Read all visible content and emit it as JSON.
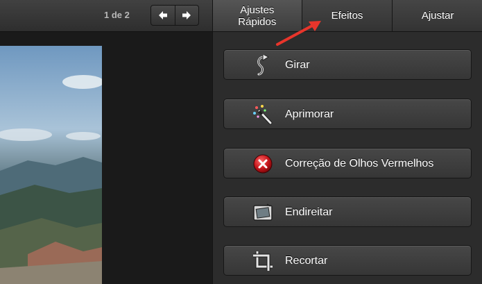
{
  "toolbar": {
    "pager": "1 de 2",
    "prev_icon": "arrow-left-icon",
    "next_icon": "arrow-right-icon"
  },
  "tabs": [
    {
      "label": "Ajustes Rápidos",
      "active": true
    },
    {
      "label": "Efeitos",
      "active": false
    },
    {
      "label": "Ajustar",
      "active": false
    }
  ],
  "tools": [
    {
      "label": "Girar",
      "icon": "rotate-icon"
    },
    {
      "label": "Aprimorar",
      "icon": "magic-wand-icon"
    },
    {
      "label": "Correção de Olhos Vermelhos",
      "icon": "red-eye-icon"
    },
    {
      "label": "Endireitar",
      "icon": "straighten-icon"
    },
    {
      "label": "Recortar",
      "icon": "crop-icon"
    }
  ],
  "annotation": {
    "color": "#e8352b",
    "points_to": "Efeitos"
  }
}
